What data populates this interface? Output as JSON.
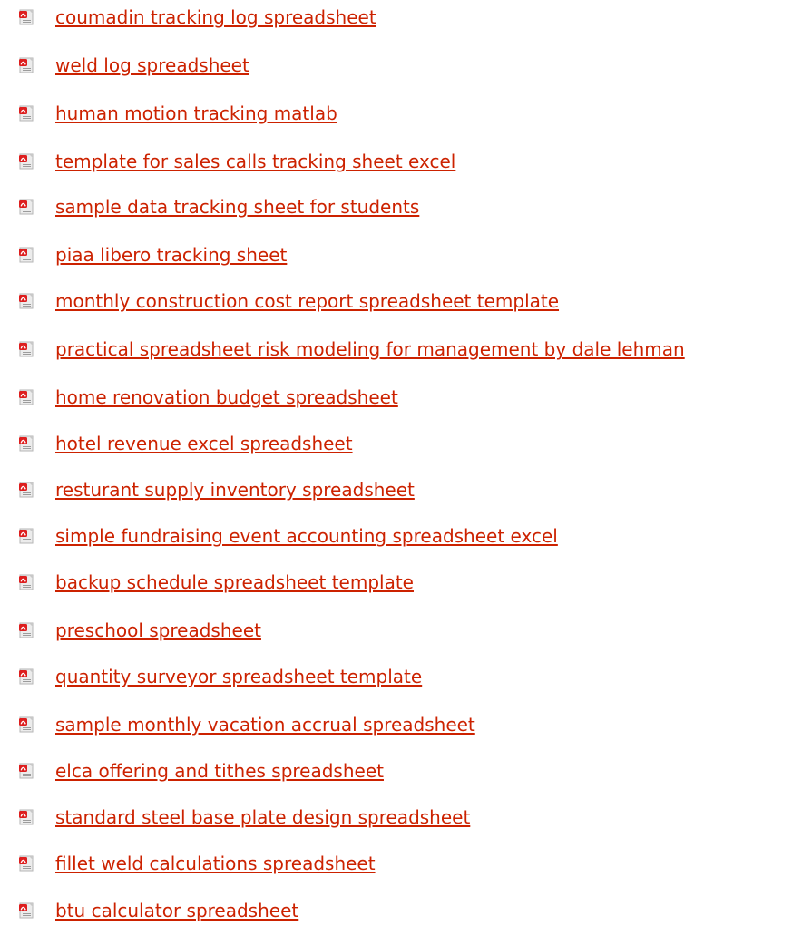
{
  "file_icon": {
    "name": "pdf-file-icon",
    "colors": {
      "page": "#ececec",
      "badge": "#dd1e1e",
      "fold": "#c8c8c8",
      "lines": "#9c9c9c"
    }
  },
  "link_color": "#cc2200",
  "links": [
    {
      "label": "coumadin tracking log spreadsheet"
    },
    {
      "label": "weld log spreadsheet"
    },
    {
      "label": "human motion tracking matlab"
    },
    {
      "label": "template for sales calls tracking sheet excel"
    },
    {
      "label": "sample data tracking sheet for students"
    },
    {
      "label": "piaa libero tracking sheet"
    },
    {
      "label": "monthly construction cost report spreadsheet template"
    },
    {
      "label": "practical spreadsheet risk modeling for management by dale lehman"
    },
    {
      "label": "home renovation budget spreadsheet"
    },
    {
      "label": "hotel revenue excel spreadsheet"
    },
    {
      "label": "resturant supply inventory spreadsheet"
    },
    {
      "label": "simple fundraising event accounting spreadsheet excel"
    },
    {
      "label": "backup schedule spreadsheet template"
    },
    {
      "label": "preschool spreadsheet"
    },
    {
      "label": "quantity surveyor spreadsheet template"
    },
    {
      "label": "sample monthly vacation accrual spreadsheet"
    },
    {
      "label": "elca offering and tithes spreadsheet"
    },
    {
      "label": "standard steel base plate design spreadsheet"
    },
    {
      "label": "fillet weld calculations spreadsheet"
    },
    {
      "label": "btu calculator spreadsheet"
    }
  ]
}
